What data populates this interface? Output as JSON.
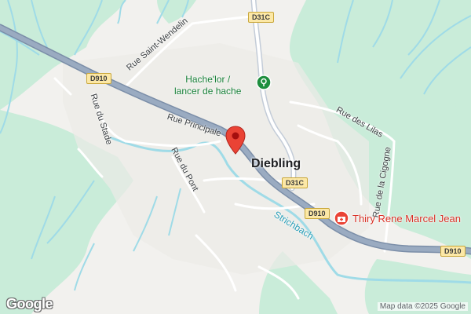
{
  "map": {
    "town": "Diebling",
    "streets": {
      "rue_principale": "Rue Principale",
      "rue_saint_wendelin": "Rue Saint-Wendelin",
      "rue_du_stade": "Rue du Stade",
      "rue_du_pont": "Rue du Pont",
      "rue_des_lilas": "Rue des Lilas",
      "rue_de_la_cigogne": "Rue de la Cigogne"
    },
    "road_shields": {
      "d31c_top": "D31C",
      "d31c_mid": "D31C",
      "d910_left": "D910",
      "d910_mid": "D910",
      "d910_right": "D910"
    },
    "waterway": "Strichbach",
    "pois": {
      "hachelor_line1": "Hache'lor /",
      "hachelor_line2": "lancer de hache",
      "thiry": "Thiry Rene Marcel Jean"
    },
    "logo": "Google",
    "attribution": "Map data ©2025 Google",
    "colors": {
      "land": "#f2f1ee",
      "park": "#c9ecd9",
      "water": "#9fdbe7",
      "highway": "#8fa1b8",
      "road": "#ffffff",
      "pin": "#ea4335",
      "poi_green": "#188038",
      "poi_red": "#d93025"
    },
    "icons": [
      "map-pin-icon",
      "activity-poi-icon",
      "medical-poi-icon"
    ]
  }
}
